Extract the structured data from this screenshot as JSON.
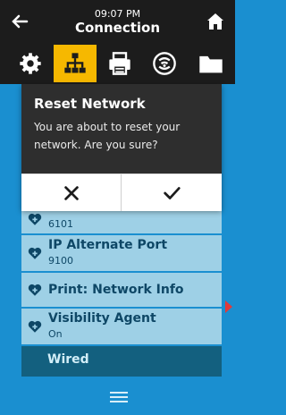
{
  "header": {
    "time": "09:07 PM",
    "title": "Connection"
  },
  "tabs": [
    {
      "icon": "gear-icon"
    },
    {
      "icon": "network-icon",
      "active": true
    },
    {
      "icon": "printer-icon"
    },
    {
      "icon": "wireless-icon"
    },
    {
      "icon": "folder-icon"
    }
  ],
  "list": {
    "partial_row_value": "6101",
    "items": [
      {
        "label": "IP Alternate Port",
        "value": "9100"
      },
      {
        "label": "Print: Network Info"
      },
      {
        "label": "Visibility Agent",
        "value": "On"
      }
    ],
    "section_label": "Wired"
  },
  "dialog": {
    "title": "Reset Network",
    "message": "You are about to reset your network. Are you sure?",
    "cancel_icon": "close-icon",
    "confirm_icon": "checkmark-icon"
  },
  "colors": {
    "header_bg": "#1c1c1c",
    "accent": "#f6b800",
    "page_bg": "#1a8fd0",
    "row_bg": "#9ed0e6",
    "section_bg": "#13607f"
  }
}
